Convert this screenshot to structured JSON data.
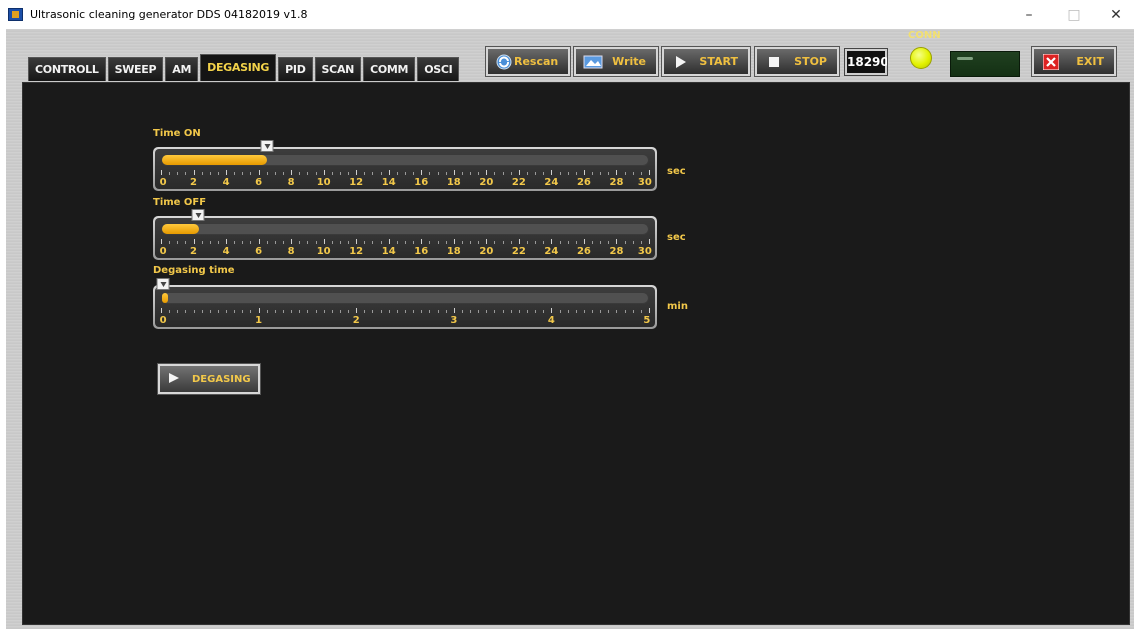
{
  "window": {
    "title": "Ultrasonic cleaning generator DDS 04182019 v1.8",
    "controls": {
      "minimize": "–",
      "maximize": "□",
      "close": "✕"
    }
  },
  "tabs": [
    {
      "label": "CONTROLL",
      "active": false
    },
    {
      "label": "SWEEP",
      "active": false
    },
    {
      "label": "AM",
      "active": false
    },
    {
      "label": "DEGASING",
      "active": true
    },
    {
      "label": "PID",
      "active": false
    },
    {
      "label": "SCAN",
      "active": false
    },
    {
      "label": "COMM",
      "active": false
    },
    {
      "label": "OSCI",
      "active": false
    }
  ],
  "toolbar": {
    "rescan_label": "Rescan",
    "write_label": "Write",
    "start_label": "START",
    "stop_label": "STOP",
    "exit_label": "EXIT",
    "counter": "18290",
    "conn_label": "CONN"
  },
  "sliders": {
    "time_on": {
      "label": "Time ON",
      "unit": "sec",
      "min": 0,
      "max": 30,
      "value": 6.5,
      "ticks": [
        "0",
        "2",
        "4",
        "6",
        "8",
        "10",
        "12",
        "14",
        "16",
        "18",
        "20",
        "22",
        "24",
        "26",
        "28",
        "30"
      ]
    },
    "time_off": {
      "label": "Time OFF",
      "unit": "sec",
      "min": 0,
      "max": 30,
      "value": 2.3,
      "ticks": [
        "0",
        "2",
        "4",
        "6",
        "8",
        "10",
        "12",
        "14",
        "16",
        "18",
        "20",
        "22",
        "24",
        "26",
        "28",
        "30"
      ]
    },
    "degasing_time": {
      "label": "Degasing time",
      "unit": "min",
      "min": 0,
      "max": 5,
      "value": 0.02,
      "ticks": [
        "0",
        "1",
        "2",
        "3",
        "4",
        "5"
      ]
    }
  },
  "degasing_button": {
    "label": "DEGASING"
  },
  "colors": {
    "accent": "#f2c84a",
    "fill": "#ffb81c",
    "panel": "#1a1a1a",
    "led": "#e3f200"
  }
}
